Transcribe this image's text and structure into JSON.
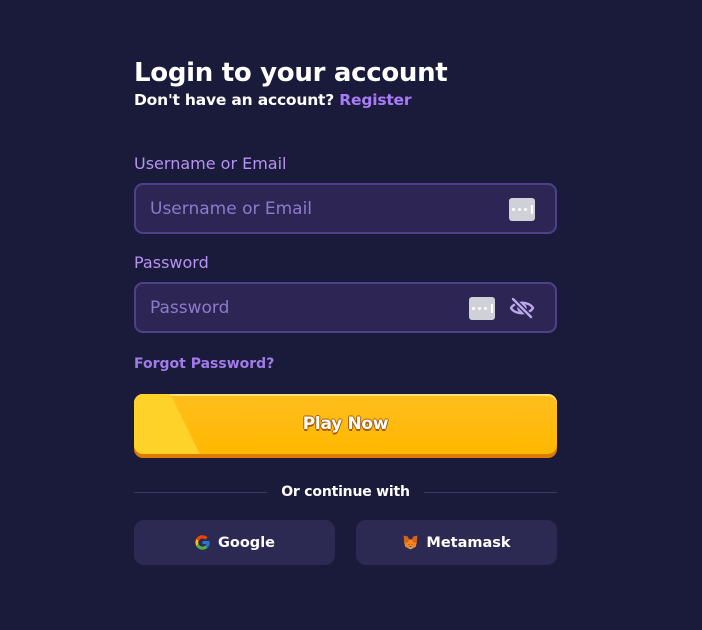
{
  "header": {
    "title": "Login to your account",
    "subtitle_prefix": "Don't have an account?",
    "register_link": "Register"
  },
  "username": {
    "label": "Username or Email",
    "placeholder": "Username or Email",
    "value": ""
  },
  "password": {
    "label": "Password",
    "placeholder": "Password",
    "value": ""
  },
  "forgot_password": "Forgot Password?",
  "primary_button": "Play Now",
  "divider_text": "Or continue with",
  "social": {
    "google_label": "Google",
    "metamask_label": "Metamask"
  },
  "icons": {
    "password_manager": "password-manager-icon",
    "visibility": "eye-slash-icon",
    "google": "google-icon",
    "metamask": "metamask-fox-icon"
  },
  "colors": {
    "background": "#1a1b3b",
    "accent": "#a77cf6",
    "label": "#b693f2",
    "input_bg": "#2d2655",
    "input_border": "#4e4189",
    "primary": "#ffb800",
    "primary_shadow": "#dd7a06",
    "social_bg": "#2c2a52"
  }
}
